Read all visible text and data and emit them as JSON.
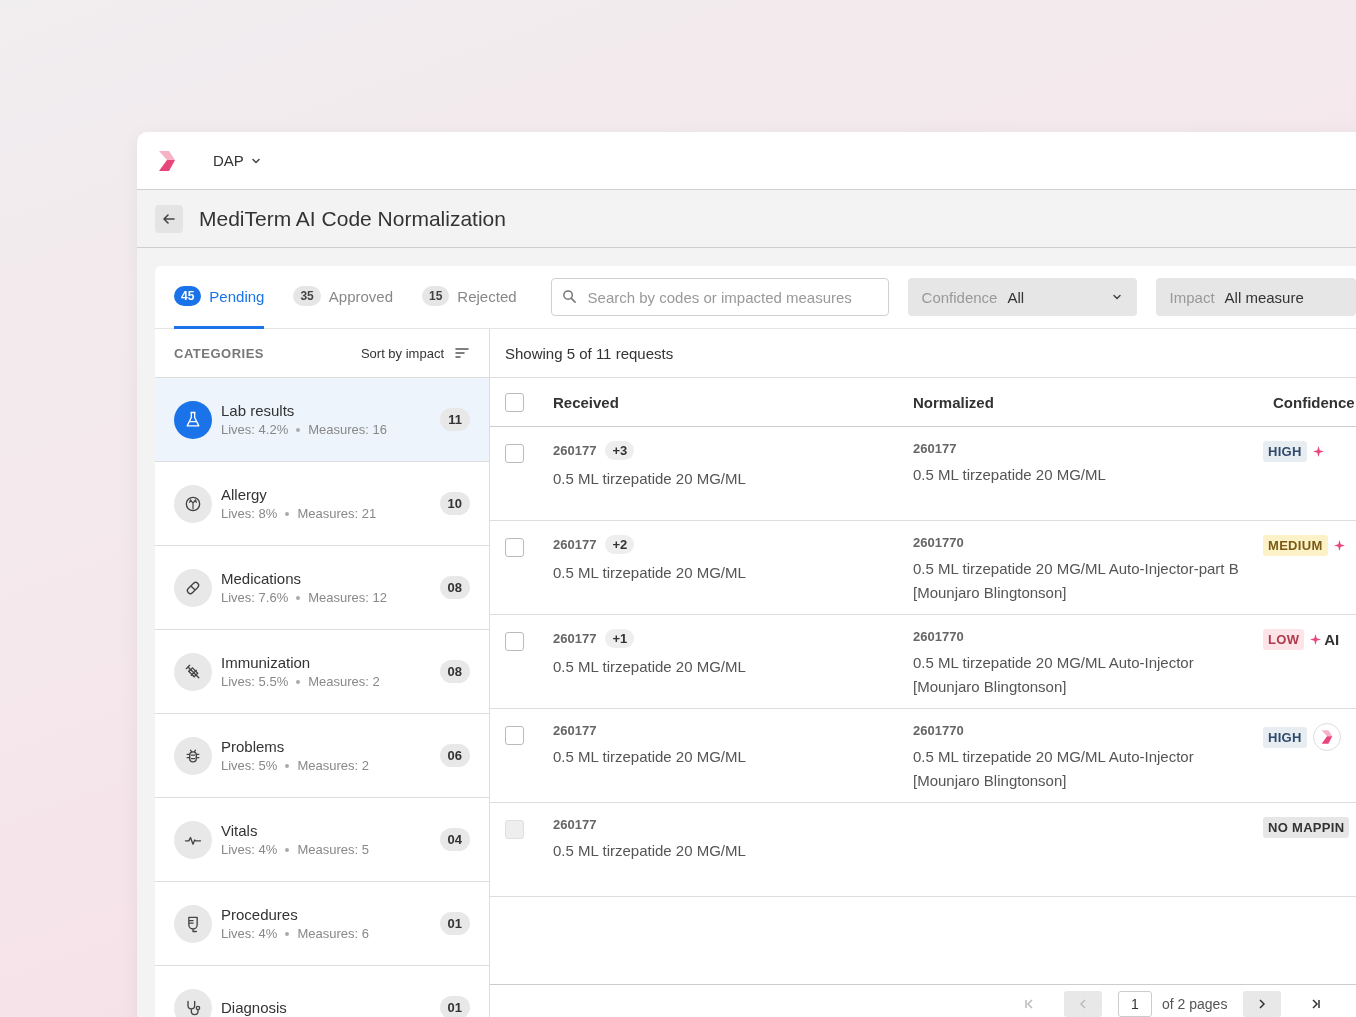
{
  "topbar": {
    "workspace": "DAP"
  },
  "page": {
    "title": "MediTerm AI Code Normalization"
  },
  "tabs": [
    {
      "count": "45",
      "label": "Pending",
      "selected": true
    },
    {
      "count": "35",
      "label": "Approved",
      "selected": false
    },
    {
      "count": "15",
      "label": "Rejected",
      "selected": false
    }
  ],
  "search": {
    "placeholder": "Search by codes or impacted measures"
  },
  "filters": [
    {
      "label": "Confidence",
      "value": "All",
      "kind": "dropdown"
    },
    {
      "label": "Impact",
      "value": "All measure",
      "kind": "cut"
    }
  ],
  "categories": {
    "title": "CATEGORIES",
    "sort": "Sort by impact",
    "items": [
      {
        "name": "Lab results",
        "lives": "Lives: 4.2%",
        "measures": "Measures: 16",
        "count": "11",
        "selected": true
      },
      {
        "name": "Allergy",
        "lives": "Lives: 8%",
        "measures": "Measures: 21",
        "count": "10",
        "selected": false
      },
      {
        "name": "Medications",
        "lives": "Lives: 7.6%",
        "measures": "Measures: 12",
        "count": "08",
        "selected": false
      },
      {
        "name": "Immunization",
        "lives": "Lives: 5.5%",
        "measures": "Measures: 2",
        "count": "08",
        "selected": false
      },
      {
        "name": "Problems",
        "lives": "Lives: 5%",
        "measures": "Measures: 2",
        "count": "06",
        "selected": false
      },
      {
        "name": "Vitals",
        "lives": "Lives: 4%",
        "measures": "Measures: 5",
        "count": "04",
        "selected": false
      },
      {
        "name": "Procedures",
        "lives": "Lives: 4%",
        "measures": "Measures: 6",
        "count": "01",
        "selected": false
      },
      {
        "name": "Diagnosis",
        "count": "01",
        "selected": false
      }
    ]
  },
  "summary": "Showing 5 of 11 requests",
  "table": {
    "columns": [
      "Received",
      "Normalized",
      "Confidence"
    ],
    "all_checked": false,
    "rows": [
      {
        "checked": false,
        "disabled": false,
        "received_code": "260177",
        "extra": "+3",
        "received": "0.5 ML tirzepatide 20 MG/ML",
        "normalized_code": "260177",
        "normalized": "0.5 ML tirzepatide 20 MG/ML",
        "confidence": {
          "color": "#e8edf2",
          "label": "HIGH"
        },
        "ai": {
          "kind": "tag"
        }
      },
      {
        "checked": false,
        "disabled": false,
        "received_code": "260177",
        "extra": "+2",
        "received": "0.5 ML tirzepatide 20 MG/ML",
        "normalized_code": "2601770",
        "normalized": "0.5 ML tirzepatide 20 MG/ML Auto-Injector-part B [Mounjaro Blingtonson]",
        "confidence": {
          "color": "#fdf1c7",
          "label": "MEDIUM"
        },
        "ai": {
          "kind": "tag"
        }
      },
      {
        "checked": false,
        "disabled": false,
        "received_code": "260177",
        "extra": "+1",
        "received": "0.5 ML tirzepatide 20 MG/ML",
        "normalized_code": "2601770",
        "normalized": "0.5 ML tirzepatide 20 MG/ML Auto-Injector [Mounjaro Blingtonson]",
        "confidence": {
          "color": "#fde4e8",
          "label": "LOW"
        },
        "ai": {
          "kind": "tag",
          "text": "AI"
        }
      },
      {
        "checked": false,
        "disabled": false,
        "received_code": "260177",
        "received": "0.5 ML tirzepatide 20 MG/ML",
        "normalized_code": "2601770",
        "normalized": "0.5 ML tirzepatide 20 MG/ML Auto-Injector [Mounjaro Blingtonson]",
        "confidence": {
          "color": "#e8edf2",
          "label": "HIGH"
        },
        "ai": {
          "kind": "avatar"
        }
      },
      {
        "checked": false,
        "disabled": true,
        "received_code": "260177",
        "received": "0.5 ML tirzepatide 20 MG/ML",
        "confidence": {
          "color": "#e6e6e6",
          "label": "NO MAPPIN"
        }
      }
    ]
  },
  "pagination": {
    "page": "1",
    "total": "of 2 pages",
    "prev_disabled": true
  }
}
